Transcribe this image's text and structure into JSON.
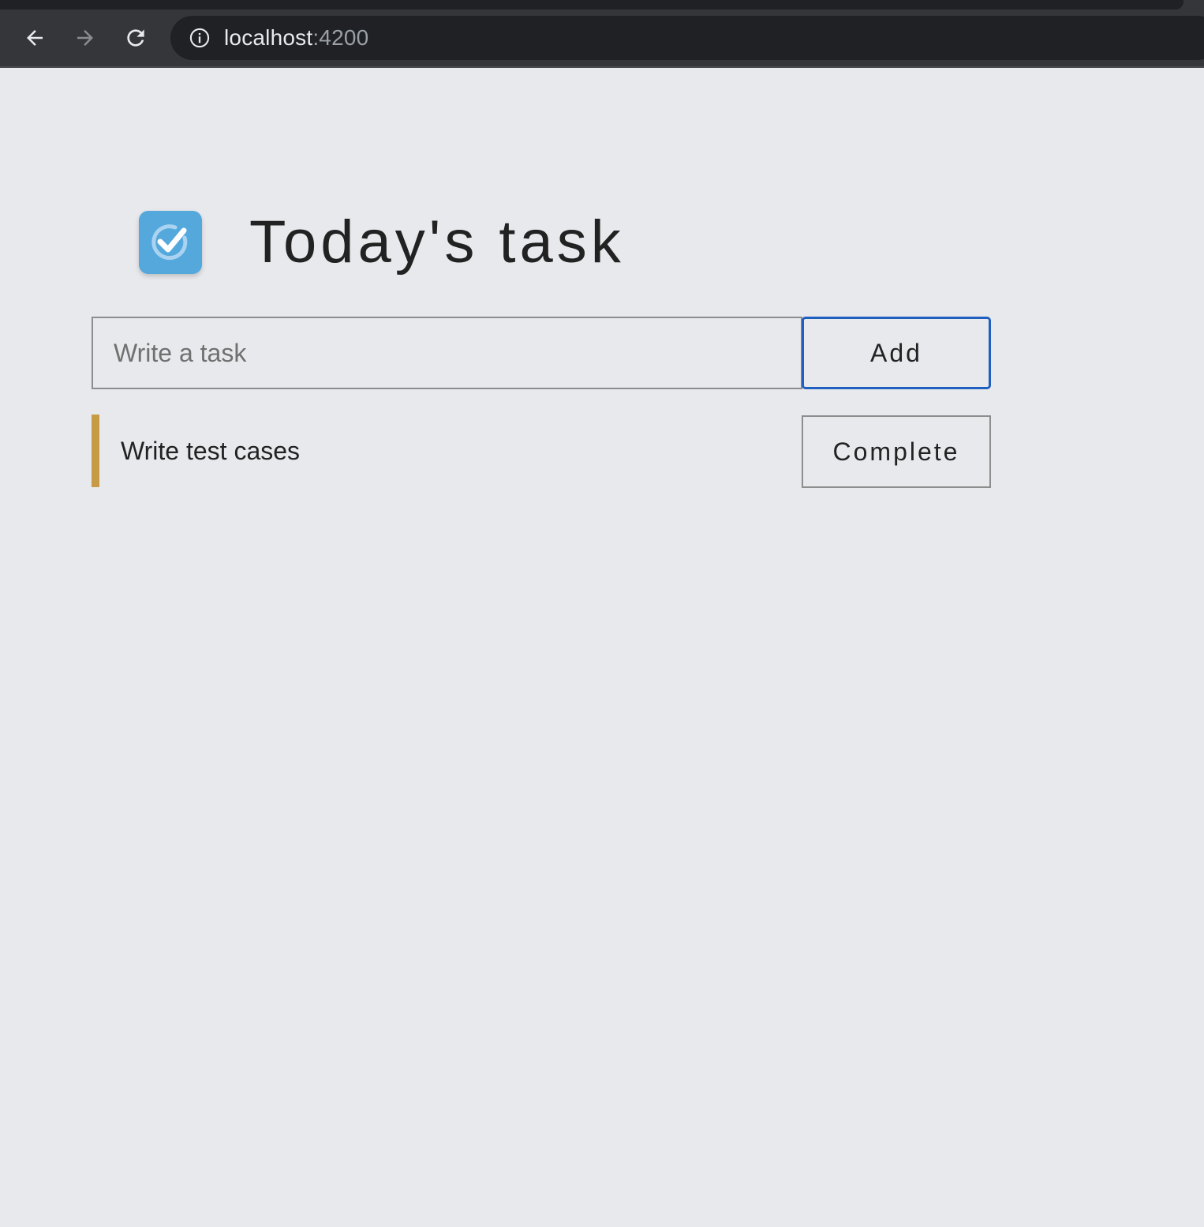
{
  "browser": {
    "url_host": "localhost",
    "url_port": ":4200",
    "icons": {
      "back": "arrow-left-icon",
      "forward": "arrow-right-icon",
      "reload": "reload-icon",
      "info": "info-icon"
    }
  },
  "app": {
    "title": "Today's task",
    "logo_icon": "checkmark-circle-icon",
    "logo_color": "#54a8dc"
  },
  "form": {
    "input_value": "",
    "input_placeholder": "Write a task",
    "add_label": "Add",
    "add_border_color": "#1f5fbf"
  },
  "tasks": [
    {
      "text": "Write test cases",
      "action_label": "Complete",
      "accent_color": "#c79a45"
    }
  ]
}
